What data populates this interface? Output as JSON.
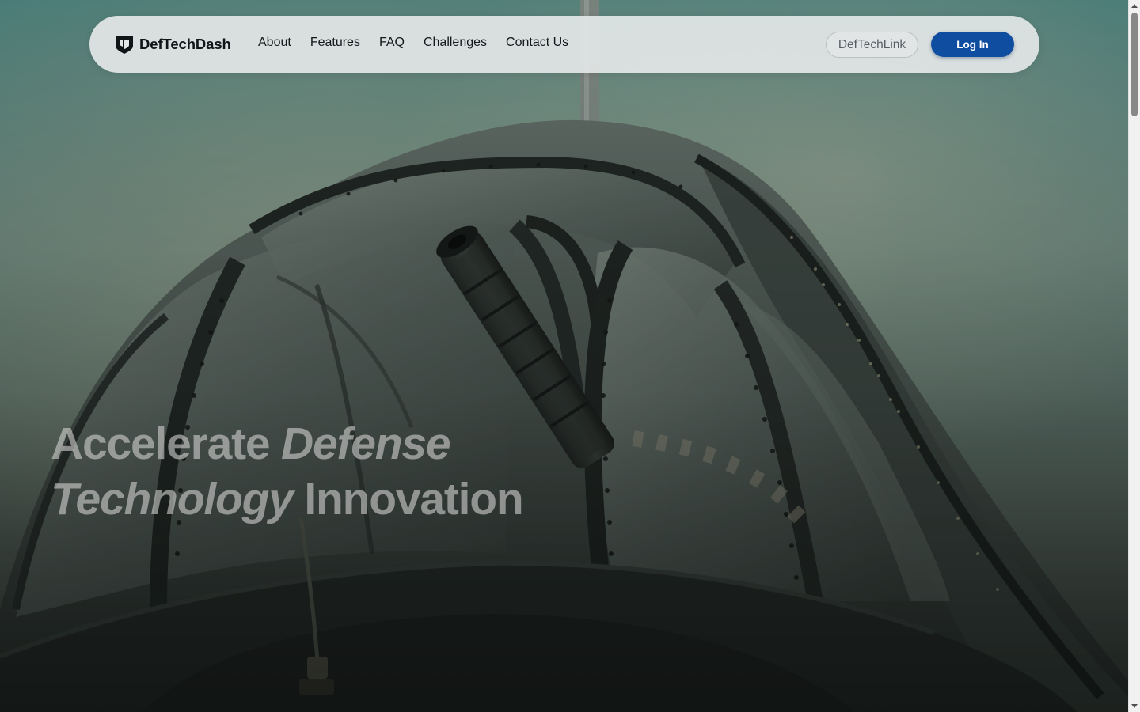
{
  "app": {
    "brand_name": "DefTechDash",
    "brand_icon": "shield-logo-icon"
  },
  "nav": {
    "links": [
      {
        "label": "About"
      },
      {
        "label": "Features"
      },
      {
        "label": "FAQ"
      },
      {
        "label": "Challenges"
      },
      {
        "label": "Contact Us"
      }
    ],
    "deftechlink_label": "DefTechLink",
    "login_label": "Log In"
  },
  "hero": {
    "headline_part1": "Accelerate",
    "headline_part2": "Defense",
    "headline_part3": "Technology",
    "headline_part4": "Innovation",
    "background_description_icon": "aircraft-gun-turret-image"
  },
  "colors": {
    "primary_button": "#0f4da0",
    "nav_background": "#e2e6e6",
    "headline_text": "#cdcdcb"
  }
}
